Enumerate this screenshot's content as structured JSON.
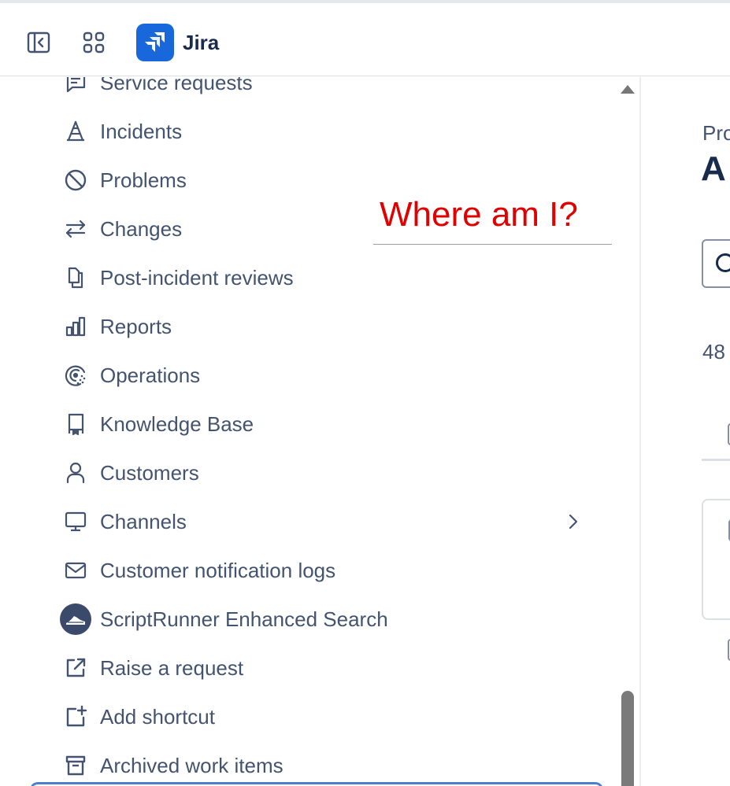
{
  "topbar": {
    "product_name": "Jira",
    "icons": [
      "sidebar-toggle-icon",
      "app-switcher-icon",
      "jira-logo-icon"
    ],
    "brand_color": "#1868db"
  },
  "sidebar": {
    "items": [
      {
        "label": "Service requests",
        "icon": "service-requests-icon"
      },
      {
        "label": "Incidents",
        "icon": "incidents-icon"
      },
      {
        "label": "Problems",
        "icon": "problems-icon"
      },
      {
        "label": "Changes",
        "icon": "changes-icon"
      },
      {
        "label": "Post-incident reviews",
        "icon": "post-incident-reviews-icon"
      },
      {
        "label": "Reports",
        "icon": "reports-icon"
      },
      {
        "label": "Operations",
        "icon": "operations-icon"
      },
      {
        "label": "Knowledge Base",
        "icon": "knowledge-base-icon"
      },
      {
        "label": "Customers",
        "icon": "customers-icon"
      },
      {
        "label": "Channels",
        "icon": "channels-icon",
        "has_submenu": true
      },
      {
        "label": "Customer notification logs",
        "icon": "mail-icon"
      },
      {
        "label": "ScriptRunner Enhanced Search",
        "icon": "scriptrunner-icon"
      },
      {
        "label": "Raise a request",
        "icon": "external-link-icon"
      },
      {
        "label": "Add shortcut",
        "icon": "add-shortcut-icon"
      },
      {
        "label": "Archived work items",
        "icon": "archive-icon"
      }
    ]
  },
  "annotation": {
    "text": "Where am I?",
    "color": "#e00000"
  },
  "main": {
    "breadcrumb_partial": "Pro",
    "title_partial": "A",
    "count_partial": "48"
  }
}
